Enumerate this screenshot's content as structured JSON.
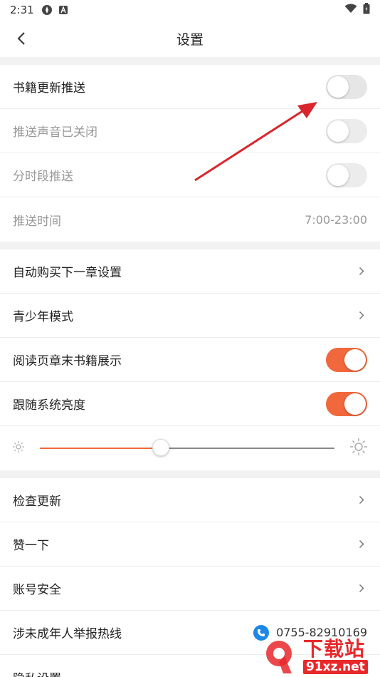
{
  "status_bar": {
    "time": "2:31"
  },
  "header": {
    "title": "设置"
  },
  "sections": {
    "push": {
      "book_update_push": "书籍更新推送",
      "push_sound_off": "推送声音已关闭",
      "timed_push": "分时段推送",
      "push_time": "推送时间",
      "push_time_value": "7:00-23:00"
    },
    "reading": {
      "auto_buy": "自动购买下一章设置",
      "teen_mode": "青少年模式",
      "chapter_end_books": "阅读页章末书籍展示",
      "follow_brightness": "跟随系统亮度",
      "brightness_level": 0.41
    },
    "other": {
      "check_update": "检查更新",
      "like": "赞一下",
      "account_security": "账号安全",
      "minor_report_hotline": "涉未成年人举报热线",
      "hotline_number": "0755-82910169",
      "privacy_settings": "隐私设置"
    }
  },
  "watermark": {
    "big": "下载站",
    "small": "91xz.net"
  },
  "colors": {
    "accent": "#f0683c",
    "arrow": "#d9262c",
    "phone": "#1e88e5"
  }
}
